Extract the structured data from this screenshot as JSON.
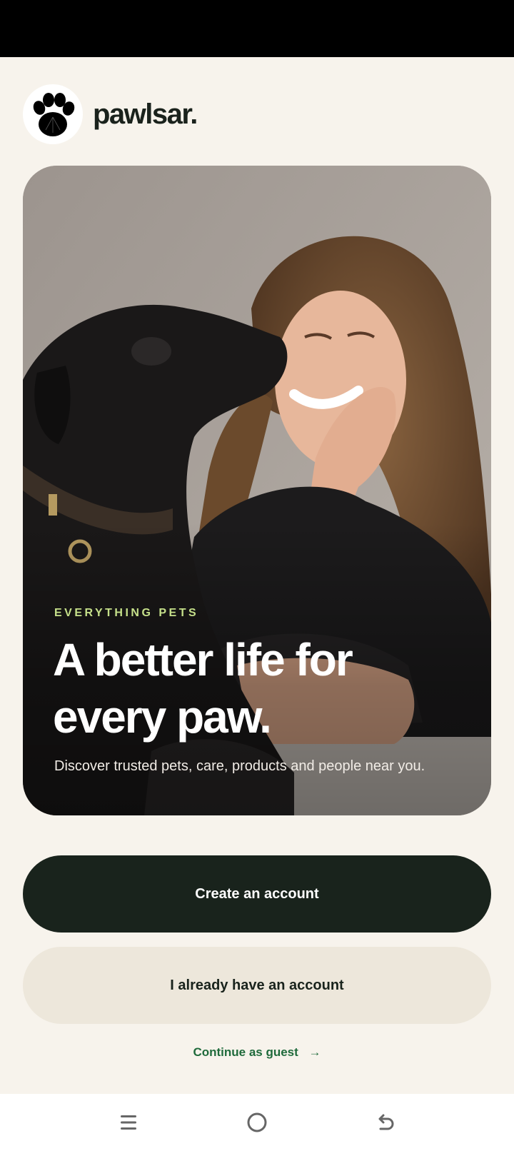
{
  "brand": {
    "name": "pawlsar.",
    "logo_icon": "paw-print-icon"
  },
  "hero": {
    "eyebrow": "EVERYTHING PETS",
    "title": "A better life for every paw.",
    "subtitle": "Discover trusted pets, care, products and people near you.",
    "image_subject": "dog-kissing-woman-photo"
  },
  "actions": {
    "create_account": "Create an account",
    "login": "I already have an account",
    "guest": "Continue as guest",
    "guest_arrow": "→"
  },
  "nav_bar": {
    "recents_icon": "menu-lines-icon",
    "home_icon": "circle-home-icon",
    "back_icon": "back-arrow-icon"
  },
  "colors": {
    "background": "#f7f3ec",
    "primary_button": "#19231c",
    "secondary_button": "#ede7db",
    "accent_eyebrow": "#c6e08a",
    "link": "#1f6a3b"
  }
}
